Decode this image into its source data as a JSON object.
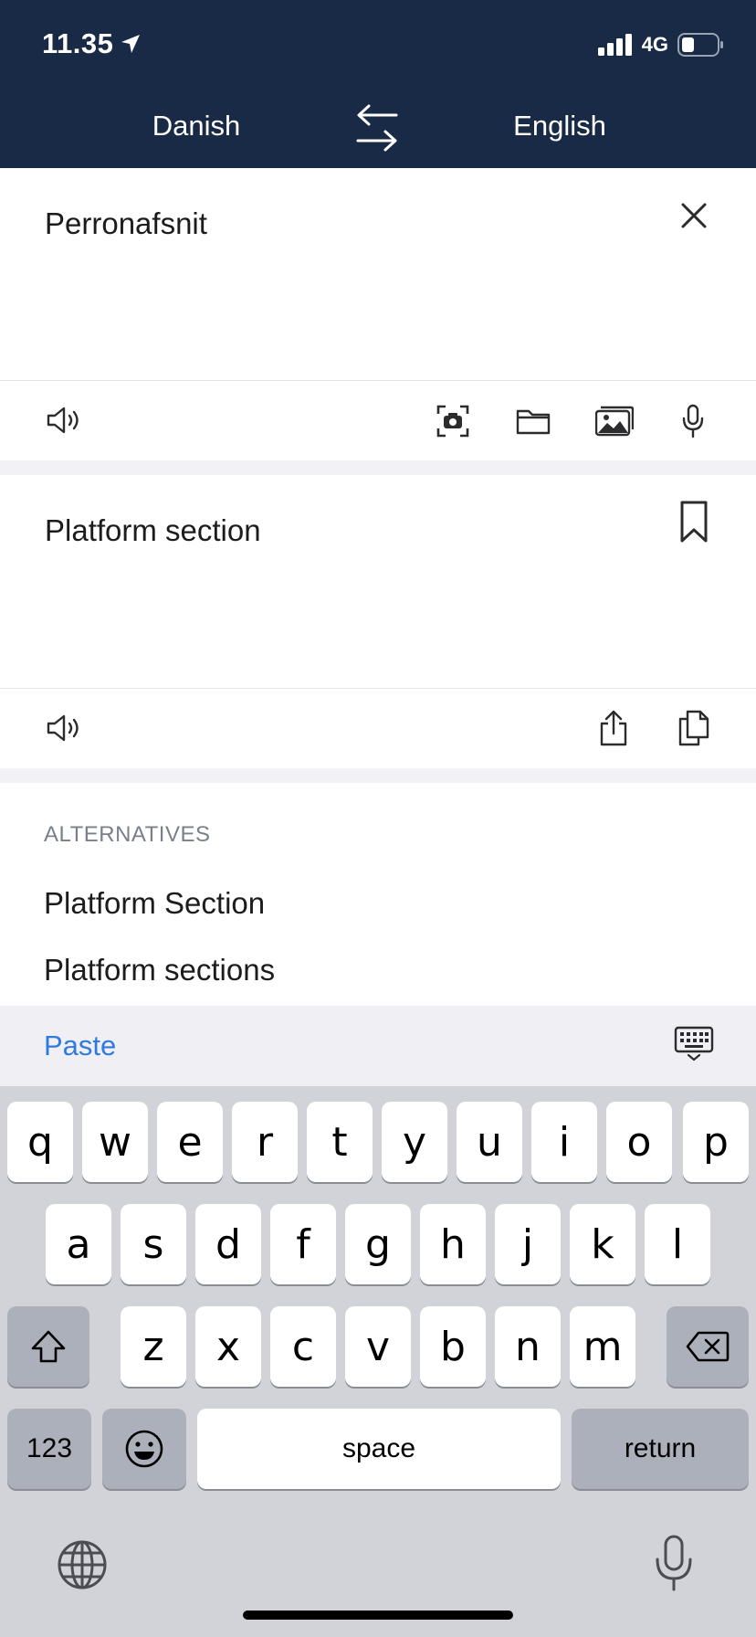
{
  "status_bar": {
    "time": "11.35",
    "network": "4G"
  },
  "header": {
    "source_language": "Danish",
    "target_language": "English"
  },
  "source": {
    "text": "Perronafsnit"
  },
  "result": {
    "text": "Platform section"
  },
  "alternatives": {
    "title": "ALTERNATIVES",
    "items": [
      "Platform Section",
      "Platform sections"
    ]
  },
  "keyboard": {
    "paste_label": "Paste",
    "row1": [
      "q",
      "w",
      "e",
      "r",
      "t",
      "y",
      "u",
      "i",
      "o",
      "p"
    ],
    "row2": [
      "a",
      "s",
      "d",
      "f",
      "g",
      "h",
      "j",
      "k",
      "l"
    ],
    "row3": [
      "z",
      "x",
      "c",
      "v",
      "b",
      "n",
      "m"
    ],
    "numbers_label": "123",
    "space_label": "space",
    "return_label": "return"
  },
  "colors": {
    "header_bg": "#182a45",
    "accent": "#2f7ae0"
  }
}
